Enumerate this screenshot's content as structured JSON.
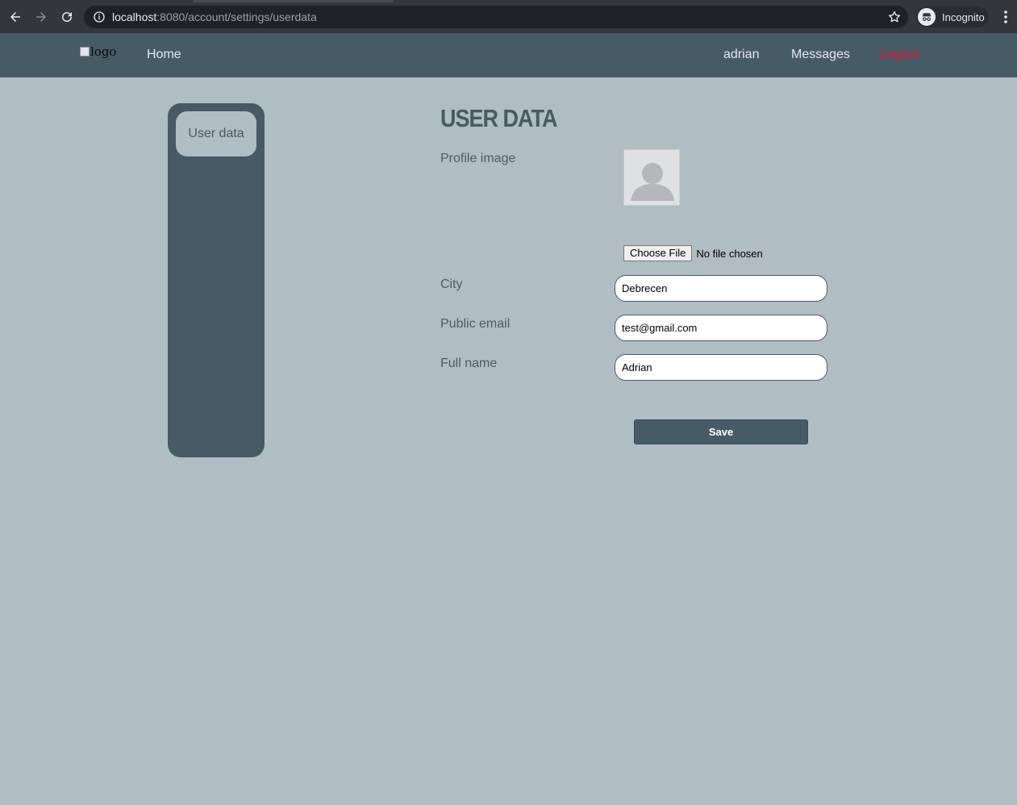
{
  "browser": {
    "url_host": "localhost",
    "url_path": ":8080/account/settings/userdata",
    "incognito_label": "Incognito"
  },
  "navbar": {
    "logo_alt": "logo",
    "home": "Home",
    "username": "adrian",
    "messages": "Messages",
    "logout": "Logout"
  },
  "sidebar": {
    "items": [
      {
        "label": "User data"
      }
    ]
  },
  "form": {
    "title": "USER DATA",
    "profile_image_label": "Profile image",
    "file_button": "Choose File",
    "file_status": "No file chosen",
    "city_label": "City",
    "city_value": "Debrecen",
    "email_label": "Public email",
    "email_value": "test@gmail.com",
    "fullname_label": "Full name",
    "fullname_value": "Adrian",
    "save_label": "Save"
  },
  "colors": {
    "page_bg": "#b0bdc3",
    "navbar_bg": "#475b65",
    "logout": "#e01636"
  }
}
